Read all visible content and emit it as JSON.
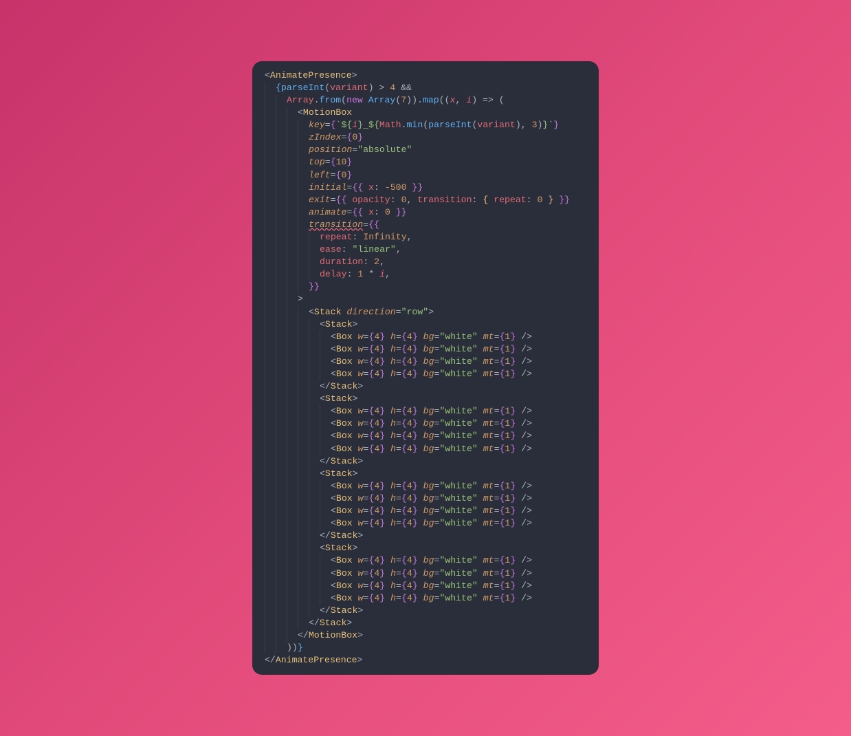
{
  "code": {
    "lines": [
      {
        "indent": 0,
        "html": "<span class='pu'>&lt;</span><span class='tag'>AnimatePresence</span><span class='pu'>&gt;</span>"
      },
      {
        "indent": 1,
        "html": "<span class='br3'>{</span><span class='fn'>parseInt</span><span class='pu'>(</span><span class='id'>variant</span><span class='pu'>)</span> <span class='pu'>&gt;</span> <span class='num'>4</span> <span class='pu'>&amp;&amp;</span>"
      },
      {
        "indent": 2,
        "html": "<span class='id'>Array</span><span class='pu'>.</span><span class='fn'>from</span><span class='pu'>(</span><span class='kw'>new</span> <span class='fn'>Array</span><span class='pu'>(</span><span class='num'>7</span><span class='pu'>)).</span><span class='fn'>map</span><span class='pu'>((</span><span class='var'>x</span><span class='pu'>,</span> <span class='var'>i</span><span class='pu'>)</span> <span class='pu'>=&gt;</span> <span class='pu'>(</span>"
      },
      {
        "indent": 3,
        "html": "<span class='pu'>&lt;</span><span class='tag'>MotionBox</span>"
      },
      {
        "indent": 4,
        "html": "<span class='attr'>key</span><span class='pu'>=</span><span class='br'>{</span><span class='str'>`${</span><span class='var'>i</span><span class='str'>}_${</span><span class='id'>Math</span><span class='pu'>.</span><span class='fn'>min</span><span class='pu'>(</span><span class='fn'>parseInt</span><span class='pu'>(</span><span class='id'>variant</span><span class='pu'>),</span> <span class='num'>3</span><span class='pu'>)</span><span class='str'>}`</span><span class='br'>}</span>"
      },
      {
        "indent": 4,
        "html": "<span class='attr'>zIndex</span><span class='pu'>=</span><span class='br'>{</span><span class='num'>0</span><span class='br'>}</span>"
      },
      {
        "indent": 4,
        "html": "<span class='attr'>position</span><span class='pu'>=</span><span class='str'>\"absolute\"</span>"
      },
      {
        "indent": 4,
        "html": "<span class='attr'>top</span><span class='pu'>=</span><span class='br'>{</span><span class='num'>10</span><span class='br'>}</span>"
      },
      {
        "indent": 4,
        "html": "<span class='attr'>left</span><span class='pu'>=</span><span class='br'>{</span><span class='num'>0</span><span class='br'>}</span>"
      },
      {
        "indent": 4,
        "html": "<span class='attr'>initial</span><span class='pu'>=</span><span class='br'>{{</span> <span class='prop'>x</span><span class='pu'>:</span> <span class='num'>-500</span> <span class='br'>}}</span>"
      },
      {
        "indent": 4,
        "html": "<span class='attr'>exit</span><span class='pu'>=</span><span class='br'>{{</span> <span class='prop'>opacity</span><span class='pu'>:</span> <span class='num'>0</span><span class='pu'>,</span> <span class='prop'>transition</span><span class='pu'>:</span> <span class='br2'>{</span> <span class='prop'>repeat</span><span class='pu'>:</span> <span class='num'>0</span> <span class='br2'>}</span> <span class='br'>}}</span>"
      },
      {
        "indent": 4,
        "html": "<span class='attr'>animate</span><span class='pu'>=</span><span class='br'>{{</span> <span class='prop'>x</span><span class='pu'>:</span> <span class='num'>0</span> <span class='br'>}}</span>"
      },
      {
        "indent": 4,
        "html": "<span class='attr wavy'>transition</span><span class='pu'>=</span><span class='br'>{{</span>"
      },
      {
        "indent": 5,
        "html": "<span class='prop'>repeat</span><span class='pu'>:</span> <span class='cnst'>Infinity</span><span class='pu'>,</span>"
      },
      {
        "indent": 5,
        "html": "<span class='prop'>ease</span><span class='pu'>:</span> <span class='str'>\"linear\"</span><span class='pu'>,</span>"
      },
      {
        "indent": 5,
        "html": "<span class='prop'>duration</span><span class='pu'>:</span> <span class='num'>2</span><span class='pu'>,</span>"
      },
      {
        "indent": 5,
        "html": "<span class='prop'>delay</span><span class='pu'>:</span> <span class='num'>1</span> <span class='pu'>*</span> <span class='var'>i</span><span class='pu'>,</span>"
      },
      {
        "indent": 4,
        "html": "<span class='br'>}}</span>"
      },
      {
        "indent": 3,
        "html": "<span class='pu'>&gt;</span>"
      },
      {
        "indent": 4,
        "html": "<span class='pu'>&lt;</span><span class='tag'>Stack</span> <span class='attr'>direction</span><span class='pu'>=</span><span class='str'>\"row\"</span><span class='pu'>&gt;</span>"
      },
      {
        "indent": 5,
        "html": "<span class='pu'>&lt;</span><span class='tag'>Stack</span><span class='pu'>&gt;</span>"
      },
      {
        "indent": 6,
        "html": "<span class='pu'>&lt;</span><span class='tag'>Box</span> <span class='attr'>w</span><span class='pu'>=</span><span class='br'>{</span><span class='num'>4</span><span class='br'>}</span> <span class='attr'>h</span><span class='pu'>=</span><span class='br'>{</span><span class='num'>4</span><span class='br'>}</span> <span class='attr'>bg</span><span class='pu'>=</span><span class='str'>\"white\"</span> <span class='attr'>mt</span><span class='pu'>=</span><span class='br'>{</span><span class='num'>1</span><span class='br'>}</span> <span class='pu'>/&gt;</span>"
      },
      {
        "indent": 6,
        "html": "<span class='pu'>&lt;</span><span class='tag'>Box</span> <span class='attr'>w</span><span class='pu'>=</span><span class='br'>{</span><span class='num'>4</span><span class='br'>}</span> <span class='attr'>h</span><span class='pu'>=</span><span class='br'>{</span><span class='num'>4</span><span class='br'>}</span> <span class='attr'>bg</span><span class='pu'>=</span><span class='str'>\"white\"</span> <span class='attr'>mt</span><span class='pu'>=</span><span class='br'>{</span><span class='num'>1</span><span class='br'>}</span> <span class='pu'>/&gt;</span>"
      },
      {
        "indent": 6,
        "html": "<span class='pu'>&lt;</span><span class='tag'>Box</span> <span class='attr'>w</span><span class='pu'>=</span><span class='br'>{</span><span class='num'>4</span><span class='br'>}</span> <span class='attr'>h</span><span class='pu'>=</span><span class='br'>{</span><span class='num'>4</span><span class='br'>}</span> <span class='attr'>bg</span><span class='pu'>=</span><span class='str'>\"white\"</span> <span class='attr'>mt</span><span class='pu'>=</span><span class='br'>{</span><span class='num'>1</span><span class='br'>}</span> <span class='pu'>/&gt;</span>"
      },
      {
        "indent": 6,
        "html": "<span class='pu'>&lt;</span><span class='tag'>Box</span> <span class='attr'>w</span><span class='pu'>=</span><span class='br'>{</span><span class='num'>4</span><span class='br'>}</span> <span class='attr'>h</span><span class='pu'>=</span><span class='br'>{</span><span class='num'>4</span><span class='br'>}</span> <span class='attr'>bg</span><span class='pu'>=</span><span class='str'>\"white\"</span> <span class='attr'>mt</span><span class='pu'>=</span><span class='br'>{</span><span class='num'>1</span><span class='br'>}</span> <span class='pu'>/&gt;</span>"
      },
      {
        "indent": 5,
        "html": "<span class='pu'>&lt;/</span><span class='tag'>Stack</span><span class='pu'>&gt;</span>"
      },
      {
        "indent": 5,
        "html": "<span class='pu'>&lt;</span><span class='tag'>Stack</span><span class='pu'>&gt;</span>"
      },
      {
        "indent": 6,
        "html": "<span class='pu'>&lt;</span><span class='tag'>Box</span> <span class='attr'>w</span><span class='pu'>=</span><span class='br'>{</span><span class='num'>4</span><span class='br'>}</span> <span class='attr'>h</span><span class='pu'>=</span><span class='br'>{</span><span class='num'>4</span><span class='br'>}</span> <span class='attr'>bg</span><span class='pu'>=</span><span class='str'>\"white\"</span> <span class='attr'>mt</span><span class='pu'>=</span><span class='br'>{</span><span class='num'>1</span><span class='br'>}</span> <span class='pu'>/&gt;</span>"
      },
      {
        "indent": 6,
        "html": "<span class='pu'>&lt;</span><span class='tag'>Box</span> <span class='attr'>w</span><span class='pu'>=</span><span class='br'>{</span><span class='num'>4</span><span class='br'>}</span> <span class='attr'>h</span><span class='pu'>=</span><span class='br'>{</span><span class='num'>4</span><span class='br'>}</span> <span class='attr'>bg</span><span class='pu'>=</span><span class='str'>\"white\"</span> <span class='attr'>mt</span><span class='pu'>=</span><span class='br'>{</span><span class='num'>1</span><span class='br'>}</span> <span class='pu'>/&gt;</span>"
      },
      {
        "indent": 6,
        "html": "<span class='pu'>&lt;</span><span class='tag'>Box</span> <span class='attr'>w</span><span class='pu'>=</span><span class='br'>{</span><span class='num'>4</span><span class='br'>}</span> <span class='attr'>h</span><span class='pu'>=</span><span class='br'>{</span><span class='num'>4</span><span class='br'>}</span> <span class='attr'>bg</span><span class='pu'>=</span><span class='str'>\"white\"</span> <span class='attr'>mt</span><span class='pu'>=</span><span class='br'>{</span><span class='num'>1</span><span class='br'>}</span> <span class='pu'>/&gt;</span>"
      },
      {
        "indent": 6,
        "html": "<span class='pu'>&lt;</span><span class='tag'>Box</span> <span class='attr'>w</span><span class='pu'>=</span><span class='br'>{</span><span class='num'>4</span><span class='br'>}</span> <span class='attr'>h</span><span class='pu'>=</span><span class='br'>{</span><span class='num'>4</span><span class='br'>}</span> <span class='attr'>bg</span><span class='pu'>=</span><span class='str'>\"white\"</span> <span class='attr'>mt</span><span class='pu'>=</span><span class='br'>{</span><span class='num'>1</span><span class='br'>}</span> <span class='pu'>/&gt;</span>"
      },
      {
        "indent": 5,
        "html": "<span class='pu'>&lt;/</span><span class='tag'>Stack</span><span class='pu'>&gt;</span>"
      },
      {
        "indent": 5,
        "html": "<span class='pu'>&lt;</span><span class='tag'>Stack</span><span class='pu'>&gt;</span>"
      },
      {
        "indent": 6,
        "html": "<span class='pu'>&lt;</span><span class='tag'>Box</span> <span class='attr'>w</span><span class='pu'>=</span><span class='br'>{</span><span class='num'>4</span><span class='br'>}</span> <span class='attr'>h</span><span class='pu'>=</span><span class='br'>{</span><span class='num'>4</span><span class='br'>}</span> <span class='attr'>bg</span><span class='pu'>=</span><span class='str'>\"white\"</span> <span class='attr'>mt</span><span class='pu'>=</span><span class='br'>{</span><span class='num'>1</span><span class='br'>}</span> <span class='pu'>/&gt;</span>"
      },
      {
        "indent": 6,
        "html": "<span class='pu'>&lt;</span><span class='tag'>Box</span> <span class='attr'>w</span><span class='pu'>=</span><span class='br'>{</span><span class='num'>4</span><span class='br'>}</span> <span class='attr'>h</span><span class='pu'>=</span><span class='br'>{</span><span class='num'>4</span><span class='br'>}</span> <span class='attr'>bg</span><span class='pu'>=</span><span class='str'>\"white\"</span> <span class='attr'>mt</span><span class='pu'>=</span><span class='br'>{</span><span class='num'>1</span><span class='br'>}</span> <span class='pu'>/&gt;</span>"
      },
      {
        "indent": 6,
        "html": "<span class='pu'>&lt;</span><span class='tag'>Box</span> <span class='attr'>w</span><span class='pu'>=</span><span class='br'>{</span><span class='num'>4</span><span class='br'>}</span> <span class='attr'>h</span><span class='pu'>=</span><span class='br'>{</span><span class='num'>4</span><span class='br'>}</span> <span class='attr'>bg</span><span class='pu'>=</span><span class='str'>\"white\"</span> <span class='attr'>mt</span><span class='pu'>=</span><span class='br'>{</span><span class='num'>1</span><span class='br'>}</span> <span class='pu'>/&gt;</span>"
      },
      {
        "indent": 6,
        "html": "<span class='pu'>&lt;</span><span class='tag'>Box</span> <span class='attr'>w</span><span class='pu'>=</span><span class='br'>{</span><span class='num'>4</span><span class='br'>}</span> <span class='attr'>h</span><span class='pu'>=</span><span class='br'>{</span><span class='num'>4</span><span class='br'>}</span> <span class='attr'>bg</span><span class='pu'>=</span><span class='str'>\"white\"</span> <span class='attr'>mt</span><span class='pu'>=</span><span class='br'>{</span><span class='num'>1</span><span class='br'>}</span> <span class='pu'>/&gt;</span>"
      },
      {
        "indent": 5,
        "html": "<span class='pu'>&lt;/</span><span class='tag'>Stack</span><span class='pu'>&gt;</span>"
      },
      {
        "indent": 5,
        "html": "<span class='pu'>&lt;</span><span class='tag'>Stack</span><span class='pu'>&gt;</span>"
      },
      {
        "indent": 6,
        "html": "<span class='pu'>&lt;</span><span class='tag'>Box</span> <span class='attr'>w</span><span class='pu'>=</span><span class='br'>{</span><span class='num'>4</span><span class='br'>}</span> <span class='attr'>h</span><span class='pu'>=</span><span class='br'>{</span><span class='num'>4</span><span class='br'>}</span> <span class='attr'>bg</span><span class='pu'>=</span><span class='str'>\"white\"</span> <span class='attr'>mt</span><span class='pu'>=</span><span class='br'>{</span><span class='num'>1</span><span class='br'>}</span> <span class='pu'>/&gt;</span>"
      },
      {
        "indent": 6,
        "html": "<span class='pu'>&lt;</span><span class='tag'>Box</span> <span class='attr'>w</span><span class='pu'>=</span><span class='br'>{</span><span class='num'>4</span><span class='br'>}</span> <span class='attr'>h</span><span class='pu'>=</span><span class='br'>{</span><span class='num'>4</span><span class='br'>}</span> <span class='attr'>bg</span><span class='pu'>=</span><span class='str'>\"white\"</span> <span class='attr'>mt</span><span class='pu'>=</span><span class='br'>{</span><span class='num'>1</span><span class='br'>}</span> <span class='pu'>/&gt;</span>"
      },
      {
        "indent": 6,
        "html": "<span class='pu'>&lt;</span><span class='tag'>Box</span> <span class='attr'>w</span><span class='pu'>=</span><span class='br'>{</span><span class='num'>4</span><span class='br'>}</span> <span class='attr'>h</span><span class='pu'>=</span><span class='br'>{</span><span class='num'>4</span><span class='br'>}</span> <span class='attr'>bg</span><span class='pu'>=</span><span class='str'>\"white\"</span> <span class='attr'>mt</span><span class='pu'>=</span><span class='br'>{</span><span class='num'>1</span><span class='br'>}</span> <span class='pu'>/&gt;</span>"
      },
      {
        "indent": 6,
        "html": "<span class='pu'>&lt;</span><span class='tag'>Box</span> <span class='attr'>w</span><span class='pu'>=</span><span class='br'>{</span><span class='num'>4</span><span class='br'>}</span> <span class='attr'>h</span><span class='pu'>=</span><span class='br'>{</span><span class='num'>4</span><span class='br'>}</span> <span class='attr'>bg</span><span class='pu'>=</span><span class='str'>\"white\"</span> <span class='attr'>mt</span><span class='pu'>=</span><span class='br'>{</span><span class='num'>1</span><span class='br'>}</span> <span class='pu'>/&gt;</span>"
      },
      {
        "indent": 5,
        "html": "<span class='pu'>&lt;/</span><span class='tag'>Stack</span><span class='pu'>&gt;</span>"
      },
      {
        "indent": 4,
        "html": "<span class='pu'>&lt;/</span><span class='tag'>Stack</span><span class='pu'>&gt;</span>"
      },
      {
        "indent": 3,
        "html": "<span class='pu'>&lt;/</span><span class='tag'>MotionBox</span><span class='pu'>&gt;</span>"
      },
      {
        "indent": 2,
        "html": "<span class='pu'>))</span><span class='br3'>}</span>"
      },
      {
        "indent": 0,
        "html": "<span class='pu'>&lt;/</span><span class='tag'>AnimatePresence</span><span class='pu'>&gt;</span>"
      }
    ]
  }
}
